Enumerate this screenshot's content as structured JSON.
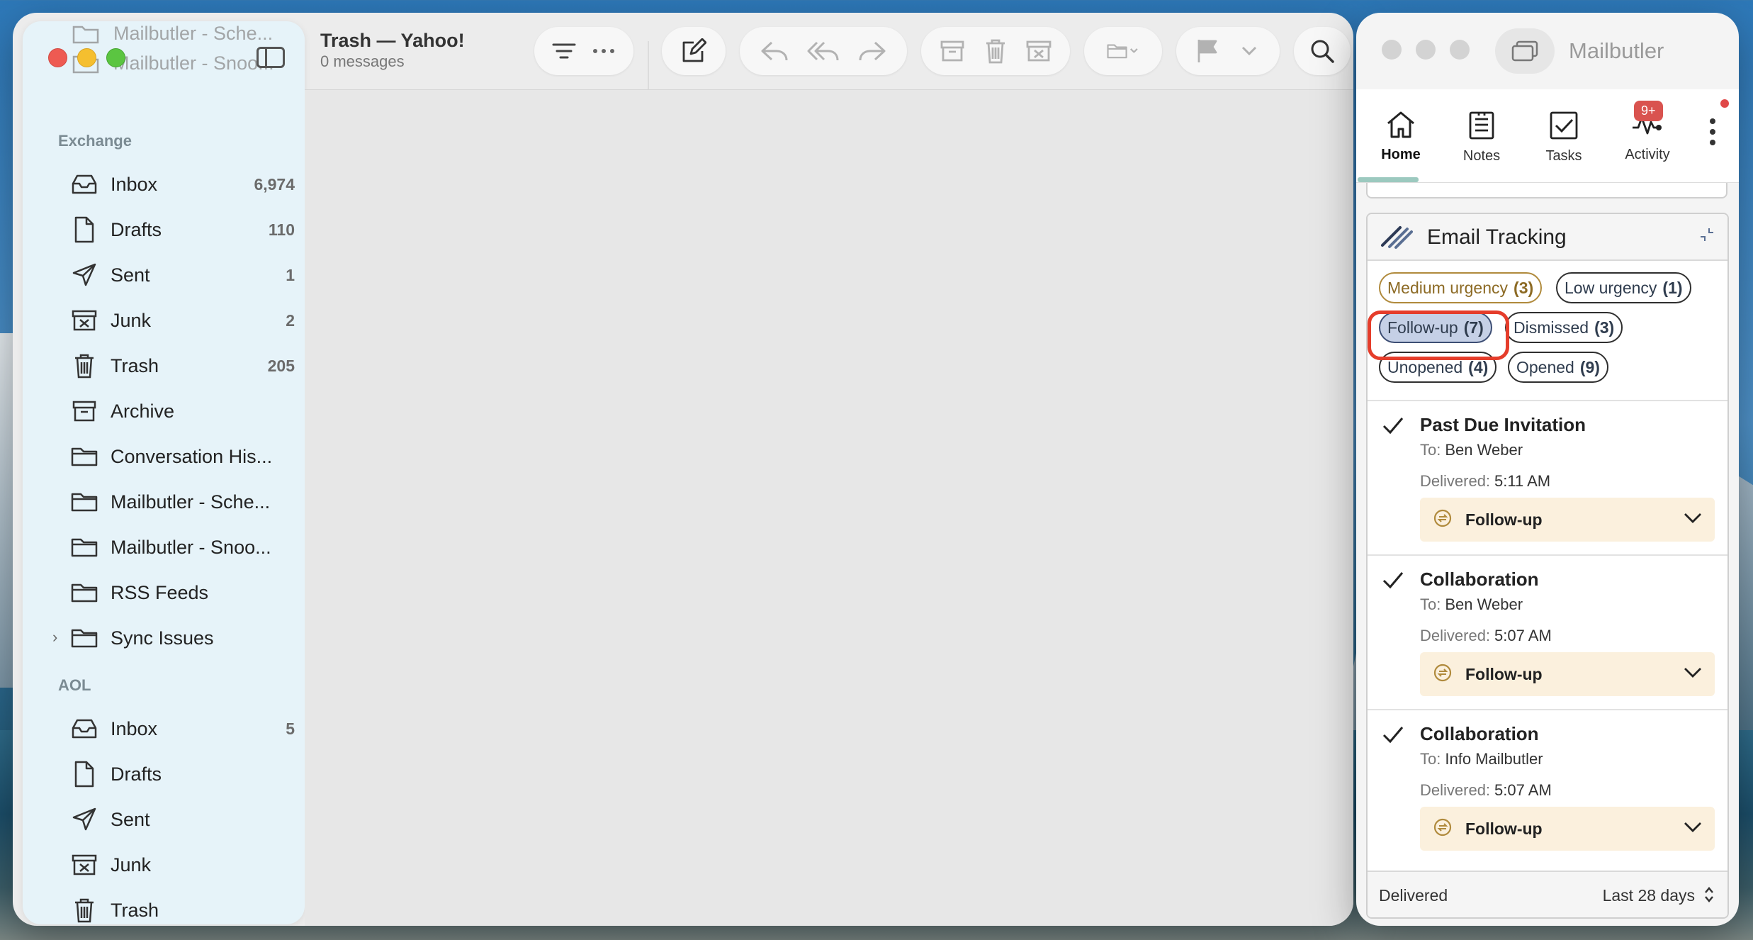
{
  "mail": {
    "header_title": "Trash — Yahoo!",
    "header_subtitle": "0 messages",
    "ghost_items": [
      "Mailbutler - Sche...",
      "Mailbutler - Snoo..."
    ],
    "sections": {
      "exchange": "Exchange",
      "aol": "AOL"
    },
    "exchange_items": [
      {
        "label": "Inbox",
        "count": "6,974",
        "icon": "inbox-icon"
      },
      {
        "label": "Drafts",
        "count": "110",
        "icon": "document-icon"
      },
      {
        "label": "Sent",
        "count": "1",
        "icon": "paperplane-icon"
      },
      {
        "label": "Junk",
        "count": "2",
        "icon": "junk-icon"
      },
      {
        "label": "Trash",
        "count": "205",
        "icon": "trash-icon"
      },
      {
        "label": "Archive",
        "count": "",
        "icon": "archive-icon"
      },
      {
        "label": "Conversation His...",
        "count": "",
        "icon": "folder-icon"
      },
      {
        "label": "Mailbutler - Sche...",
        "count": "",
        "icon": "folder-icon"
      },
      {
        "label": "Mailbutler - Snoo...",
        "count": "",
        "icon": "folder-icon"
      },
      {
        "label": "RSS Feeds",
        "count": "",
        "icon": "folder-icon"
      },
      {
        "label": "Sync Issues",
        "count": "",
        "icon": "folder-icon"
      }
    ],
    "aol_items": [
      {
        "label": "Inbox",
        "count": "5",
        "icon": "inbox-icon"
      },
      {
        "label": "Drafts",
        "count": "",
        "icon": "document-icon"
      },
      {
        "label": "Sent",
        "count": "",
        "icon": "paperplane-icon"
      },
      {
        "label": "Junk",
        "count": "",
        "icon": "junk-icon"
      },
      {
        "label": "Trash",
        "count": "",
        "icon": "trash-icon"
      }
    ]
  },
  "mailbutler": {
    "title": "Mailbutler",
    "tabs": [
      {
        "label": "Home",
        "icon": "home-icon",
        "active": true
      },
      {
        "label": "Notes",
        "icon": "notes-icon",
        "active": false
      },
      {
        "label": "Tasks",
        "icon": "tasks-icon",
        "active": false
      },
      {
        "label": "Activity",
        "icon": "activity-icon",
        "active": false
      }
    ],
    "activity_badge": "9+",
    "tracking": {
      "title": "Email Tracking",
      "filters": [
        {
          "label": "Medium urgency",
          "count": "(3)"
        },
        {
          "label": "Low urgency",
          "count": "(1)"
        },
        {
          "label": "Follow-up",
          "count": "(7)",
          "selected": true
        },
        {
          "label": "Dismissed",
          "count": "(3)"
        },
        {
          "label": "Unopened",
          "count": "(4)"
        },
        {
          "label": "Opened",
          "count": "(9)"
        }
      ],
      "to_label": "To:",
      "delivered_label": "Delivered:",
      "emails": [
        {
          "subject": "Past Due Invitation",
          "to": "Ben Weber",
          "delivered": "5:11 AM",
          "action": "Follow-up"
        },
        {
          "subject": "Collaboration",
          "to": "Ben Weber",
          "delivered": "5:07 AM",
          "action": "Follow-up"
        },
        {
          "subject": "Collaboration",
          "to": "Info Mailbutler",
          "delivered": "5:07 AM",
          "action": "Follow-up"
        }
      ],
      "footer_left": "Delivered",
      "footer_right": "Last 28 days"
    }
  },
  "colors": {
    "highlight": "#e53d2b",
    "selected_chip": "#c5d0e6",
    "followup_bg": "#fbf0dd",
    "badge": "#d9534f"
  }
}
